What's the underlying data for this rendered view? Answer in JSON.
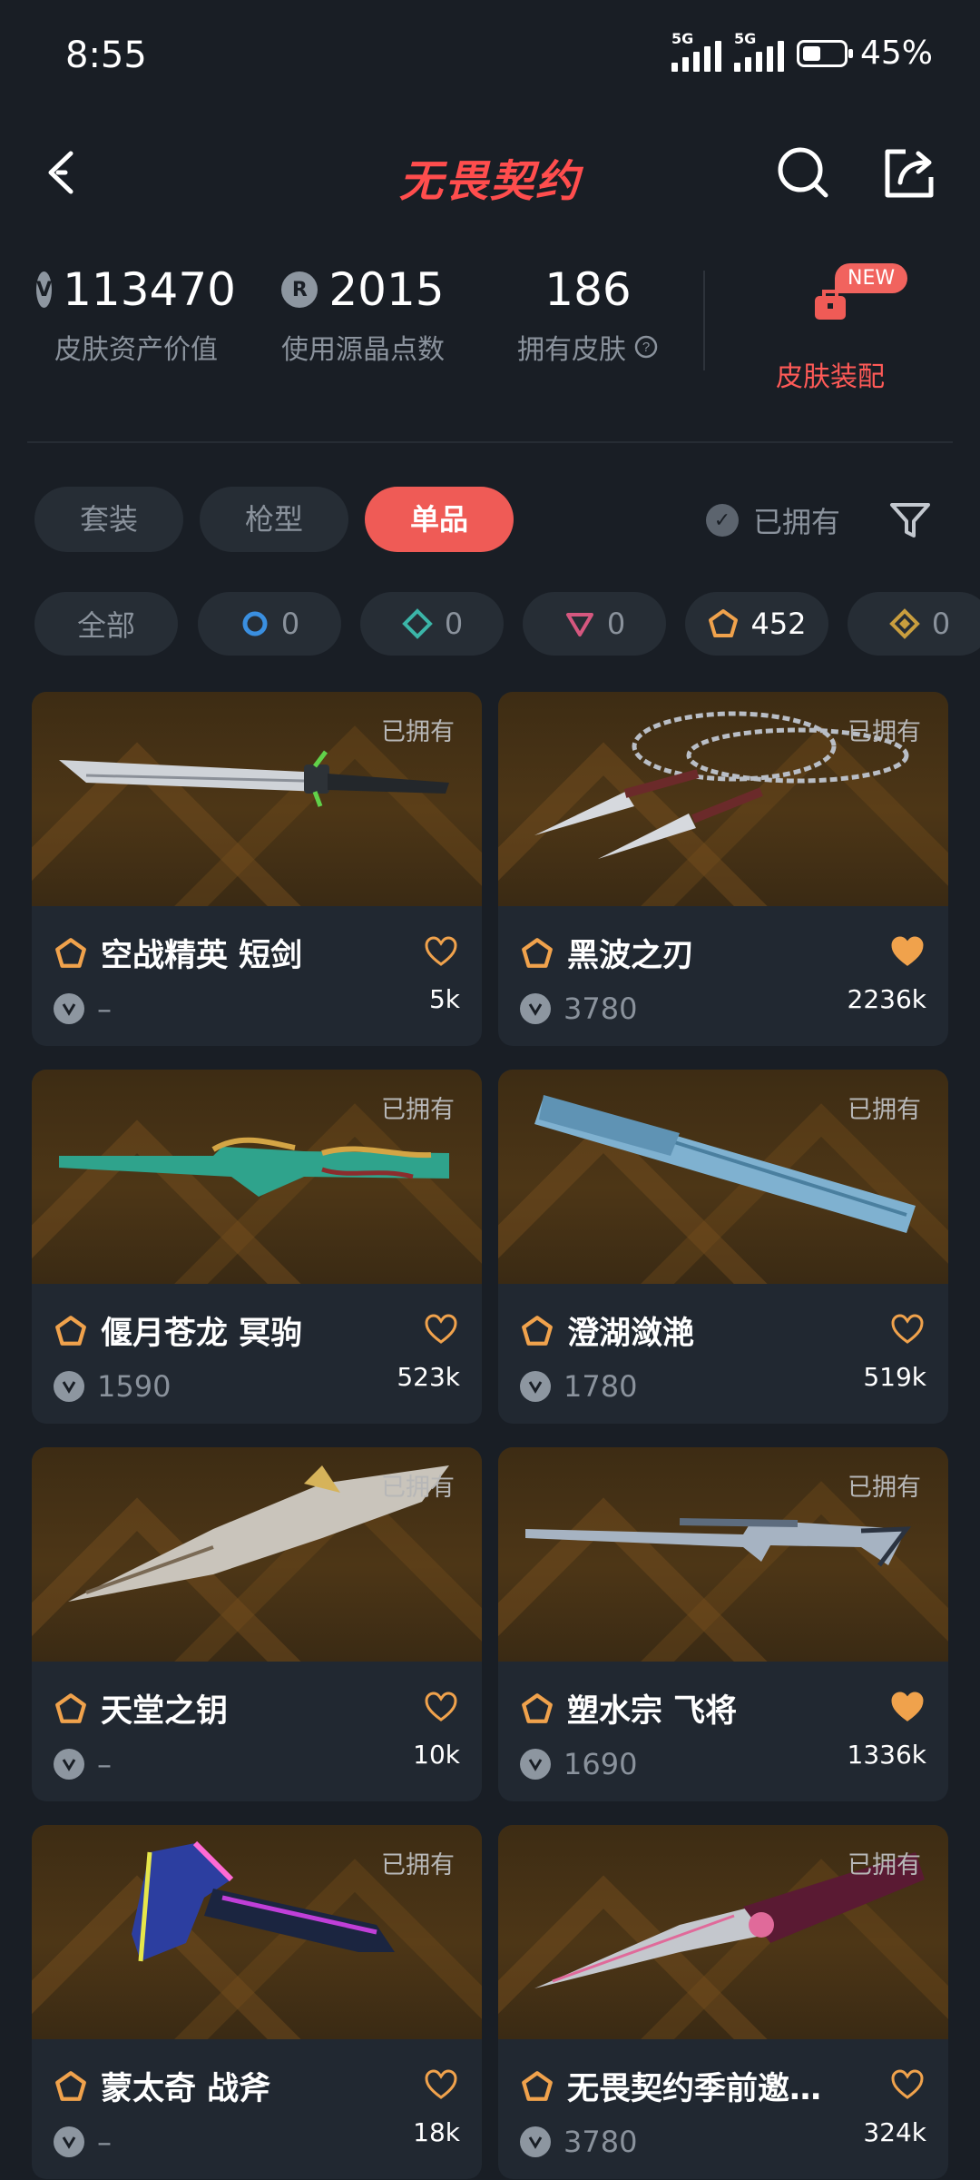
{
  "status": {
    "time": "8:55",
    "network1": "5G",
    "network2": "5G",
    "battery": "45%",
    "battery_level": 0.45
  },
  "header": {
    "title": "无畏契约",
    "back_icon": "chevron-left-icon",
    "search_icon": "search-icon",
    "share_icon": "share-icon"
  },
  "stats": {
    "asset_value": "113470",
    "asset_label": "皮肤资产价值",
    "radianite": "2015",
    "radianite_label": "使用源晶点数",
    "owned_count": "186",
    "owned_label": "拥有皮肤",
    "kit_label": "皮肤装配",
    "new_badge": "NEW"
  },
  "tabs": [
    {
      "label": "套装",
      "active": false
    },
    {
      "label": "枪型",
      "active": false
    },
    {
      "label": "单品",
      "active": true
    }
  ],
  "owned_filter": {
    "label": "已拥有"
  },
  "rarity_chips": [
    {
      "label": "全部",
      "count": ""
    },
    {
      "icon": "blue-circle-icon",
      "count": "0",
      "color": "#3a8fe0"
    },
    {
      "icon": "teal-diamond-icon",
      "count": "0",
      "color": "#3bb5a8"
    },
    {
      "icon": "pink-triangle-icon",
      "count": "0",
      "color": "#d5577f"
    },
    {
      "icon": "orange-pentagon-icon",
      "count": "452",
      "color": "#f0a24c"
    },
    {
      "icon": "gold-diamond-icon",
      "count": "0",
      "color": "#c99e3e"
    }
  ],
  "items": [
    {
      "name": "空战精英 短剑",
      "price": "–",
      "likes": "5k",
      "owned": "已拥有",
      "liked": false,
      "weapon": "knife-dagger"
    },
    {
      "name": "黑波之刃",
      "price": "3780",
      "likes": "2236k",
      "owned": "已拥有",
      "liked": true,
      "weapon": "kunai-chain"
    },
    {
      "name": "偃月苍龙 冥驹",
      "price": "1590",
      "likes": "523k",
      "owned": "已拥有",
      "liked": false,
      "weapon": "dragon-rifle"
    },
    {
      "name": "澄湖潋滟",
      "price": "1780",
      "likes": "519k",
      "owned": "已拥有",
      "liked": false,
      "weapon": "folding-fan"
    },
    {
      "name": "天堂之钥",
      "price": "–",
      "likes": "10k",
      "owned": "已拥有",
      "liked": false,
      "weapon": "ornate-blade"
    },
    {
      "name": "塑水宗 飞将",
      "price": "1690",
      "likes": "1336k",
      "owned": "已拥有",
      "liked": true,
      "weapon": "sniper-rifle"
    },
    {
      "name": "蒙太奇 战斧",
      "price": "–",
      "likes": "18k",
      "owned": "已拥有",
      "liked": false,
      "weapon": "neon-axe"
    },
    {
      "name": "无畏契约季前邀…",
      "price": "3780",
      "likes": "324k",
      "owned": "已拥有",
      "liked": false,
      "weapon": "butterfly-knife"
    }
  ],
  "colors": {
    "accent": "#ef5b56",
    "background": "#191e25",
    "card": "#212831",
    "heart": "#f0a24c"
  }
}
